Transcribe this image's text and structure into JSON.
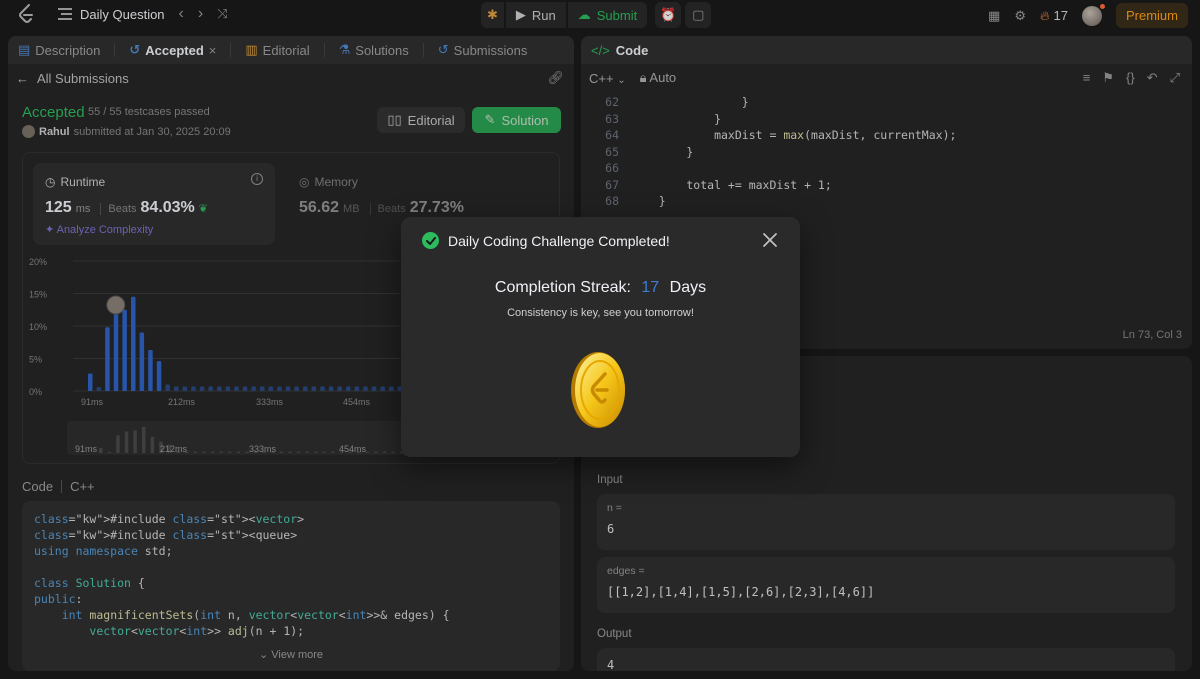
{
  "topbar": {
    "title": "Daily Question",
    "run_label": "Run",
    "submit_label": "Submit",
    "streak_count": "17",
    "premium_label": "Premium"
  },
  "left_tabs": [
    {
      "label": "Description"
    },
    {
      "label": "Accepted"
    },
    {
      "label": "Editorial"
    },
    {
      "label": "Solutions"
    },
    {
      "label": "Submissions"
    }
  ],
  "submission": {
    "back_label": "All Submissions",
    "status": "Accepted",
    "testcases": "55 / 55 testcases passed",
    "user": "Rahul",
    "submitted_at": "submitted at Jan 30, 2025 20:09",
    "editorial_button": "Editorial",
    "solution_button": "Solution"
  },
  "runtime": {
    "label": "Runtime",
    "value": "125",
    "unit": "ms",
    "beats_label": "Beats",
    "beats_value": "84.03%",
    "analyze_label": "Analyze Complexity"
  },
  "memory": {
    "label": "Memory",
    "value": "56.62",
    "unit": "MB",
    "beats_label": "Beats",
    "beats_value": "27.73%"
  },
  "chart_data": {
    "type": "bar",
    "y_ticks": [
      "20%",
      "15%",
      "10%",
      "5%",
      "0%"
    ],
    "x_ticks": [
      "91ms",
      "212ms",
      "333ms",
      "454ms"
    ],
    "ylim": [
      0,
      20
    ],
    "values": [
      2.7,
      0.6,
      9.8,
      12.0,
      12.5,
      14.5,
      9.0,
      6.3,
      4.6,
      1.0,
      0.7,
      0.7,
      0.7,
      0.7,
      0.7,
      0.7,
      0.7,
      0.7,
      0.7,
      0.7,
      0.7,
      0.7,
      0.7,
      0.7,
      0.7,
      0.7,
      0.7,
      0.7,
      0.7,
      0.7,
      0.7,
      0.7,
      0.7,
      0.7,
      0.7,
      0.7,
      0.7,
      0.7,
      0.7,
      0.7,
      0.7
    ],
    "highlight_index": 3,
    "mini_x_ticks": [
      "91ms",
      "212ms",
      "333ms",
      "454ms"
    ]
  },
  "code_section": {
    "label": "Code",
    "language": "C++",
    "view_more": "View more",
    "lines": [
      "#include <vector>",
      "#include <queue>",
      "using namespace std;",
      "",
      "class Solution {",
      "public:",
      "    int magnificentSets(int n, vector<vector<int>>& edges) {",
      "        vector<vector<int>> adj(n + 1);"
    ]
  },
  "editor": {
    "tab_label": "Code",
    "language": "C++",
    "mode": "Auto",
    "line_numbers": [
      "62",
      "63",
      "64",
      "65",
      "66",
      "67",
      "68"
    ],
    "lines": [
      "                }",
      "            }",
      "            maxDist = max(maxDist, currentMax);",
      "        }",
      "",
      "        total += maxDist + 1;",
      "    }"
    ],
    "cursor": "Ln 73, Col 3"
  },
  "testcase": {
    "input_label": "Input",
    "vars": [
      {
        "name": "n =",
        "value": "6"
      },
      {
        "name": "edges =",
        "value": "[[1,2],[1,4],[1,5],[2,6],[2,3],[4,6]]"
      }
    ],
    "output_label": "Output",
    "output_value": "4"
  },
  "modal": {
    "title": "Daily Coding Challenge Completed!",
    "streak_label": "Completion Streak:",
    "streak_value": "17",
    "streak_unit": "Days",
    "tagline": "Consistency is key, see you tomorrow!"
  },
  "colors": {
    "accent_green": "#2cbb5d",
    "bar_blue": "#2f63c7",
    "streak_blue": "#3e7bd6",
    "premium_orange": "#ffa116"
  }
}
